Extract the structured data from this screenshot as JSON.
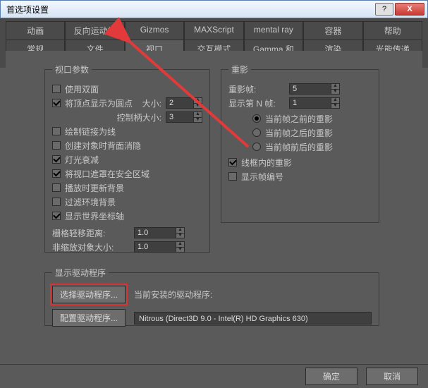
{
  "window": {
    "title": "首选项设置",
    "help": "?",
    "close": "X"
  },
  "tabs_row1": [
    "动画",
    "反向运动学",
    "Gizmos",
    "MAXScript",
    "mental ray",
    "容器",
    "帮助"
  ],
  "tabs_row2": [
    "常规",
    "文件",
    "视口",
    "交互模式",
    "Gamma 和 LUT",
    "渲染",
    "光能传递"
  ],
  "active_tab": "视口",
  "group_viewport": {
    "legend": "视口参数",
    "use_dual_face": "使用双面",
    "show_vertex_as_dot": "将顶点显示为圆点",
    "size_label": "大小:",
    "size_value": "2",
    "handle_size_label": "控制柄大小:",
    "handle_size_value": "3",
    "draw_links_as_line": "绘制链接为线",
    "backface_cull_on_create": "创建对象时背面消隐",
    "light_attenuation": "灯光衰减",
    "mask_viewport_safe": "将视口遮罩在安全区域",
    "update_bg_on_play": "播放时更新背景",
    "filter_env_bg": "过滤环境背景",
    "show_world_axis": "显示世界坐标轴",
    "grid_nudge_label": "栅格轻移距离:",
    "grid_nudge_value": "1.0",
    "non_scale_obj_label": "非缩放对象大小:",
    "non_scale_obj_value": "1.0"
  },
  "group_ghost": {
    "legend": "重影",
    "ghost_frames_label": "重影帧:",
    "ghost_frames_value": "5",
    "show_nth_label": "显示第 N 帧:",
    "show_nth_value": "1",
    "opt_before": "当前帧之前的重影",
    "opt_after": "当前帧之后的重影",
    "opt_both": "当前帧前后的重影",
    "wireframe_ghost": "线框内的重影",
    "show_frame_numbers": "显示帧编号"
  },
  "group_driver": {
    "legend": "显示驱动程序",
    "choose_driver": "选择驱动程序...",
    "config_driver": "配置驱动程序...",
    "current_label": "当前安装的驱动程序:",
    "current_value": "Nitrous (Direct3D 9.0 - Intel(R) HD Graphics 630)"
  },
  "footer": {
    "ok": "确定",
    "cancel": "取消"
  },
  "annotation_color": "#e23a3a"
}
